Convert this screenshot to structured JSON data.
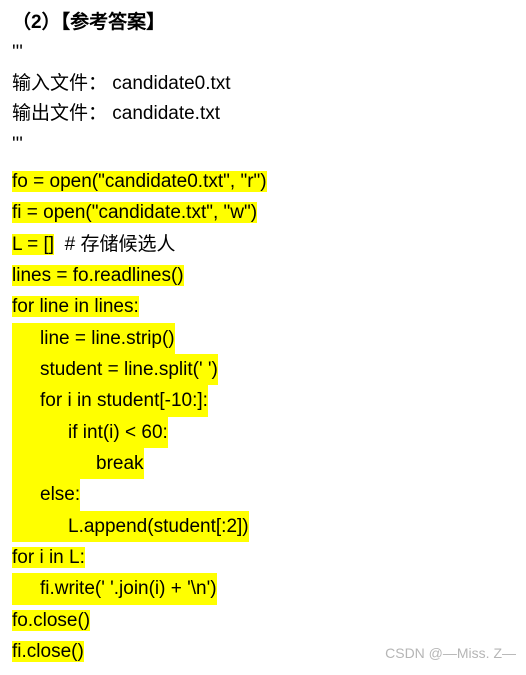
{
  "heading": "（2）【参考答案】",
  "quote1": "'''",
  "input_line": "输入文件：  candidate0.txt",
  "output_line": "输出文件：  candidate.txt",
  "quote2": "'''",
  "code": {
    "l0_blank": "",
    "l1": "fo = open(\"candidate0.txt\", \"r\")",
    "l2": "fi = open(\"candidate.txt\", \"w\")",
    "l3a": "L = []",
    "l3b": "  # 存储候选人",
    "l4": "lines = fo.readlines()",
    "l5": "for line in lines:",
    "l6": "line = line.strip()",
    "l7": "student = line.split(' ')",
    "l8": "for i in student[-10:]:",
    "l9": "if int(i) < 60:",
    "l10": "break",
    "l11": "else:",
    "l12": "L.append(student[:2])",
    "l13": "for i in L:",
    "l14": "fi.write(' '.join(i) + '\\n')",
    "l15": "fo.close()",
    "l16": "fi.close()"
  },
  "watermark": "CSDN @—Miss. Z—"
}
